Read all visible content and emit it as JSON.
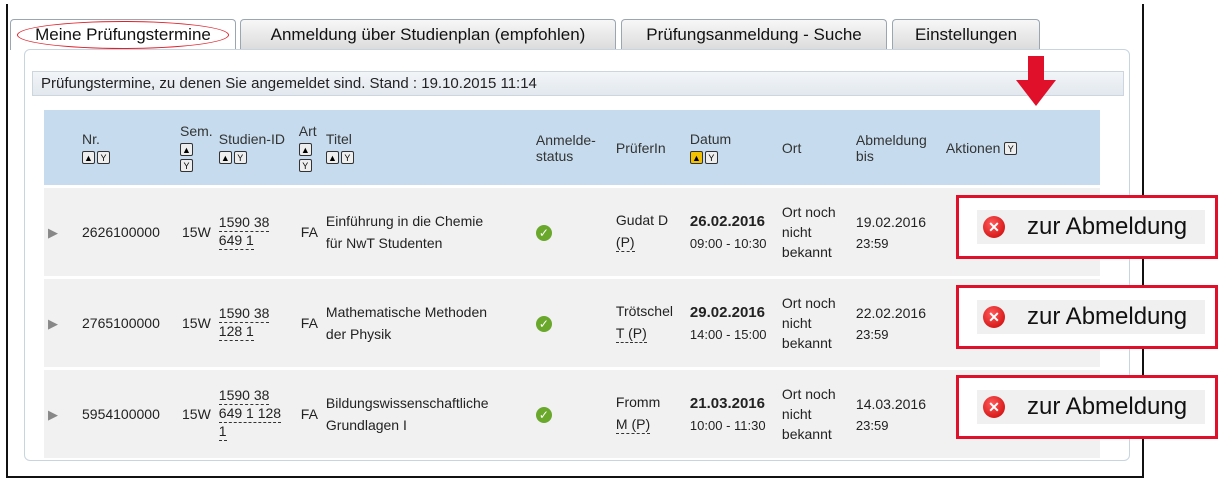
{
  "tabs": [
    {
      "label": "Meine Prüfungstermine",
      "active": true
    },
    {
      "label": "Anmeldung über Studienplan (empfohlen)",
      "active": false
    },
    {
      "label": "Prüfungsanmeldung - Suche",
      "active": false
    },
    {
      "label": "Einstellungen",
      "active": false
    }
  ],
  "section_header": "Prüfungstermine, zu denen Sie angemeldet sind. Stand : 19.10.2015 11:14",
  "columns": {
    "nr": "Nr.",
    "sem": "Sem.",
    "studien_id": "Studien-ID",
    "art": "Art",
    "titel": "Titel",
    "status_line1": "Anmelde-",
    "status_line2": "status",
    "pruefer": "PrüferIn",
    "datum": "Datum",
    "ort": "Ort",
    "abmeldung_line1": "Abmeldung",
    "abmeldung_line2": "bis",
    "aktionen": "Aktionen"
  },
  "rows": [
    {
      "nr": "2626100000",
      "sem": "15W",
      "sid_1": "1590 38",
      "sid_2": "649 1",
      "sid_3": "",
      "art": "FA",
      "titel_1": "Einführung in die Chemie",
      "titel_2": "für NwT Studenten",
      "pruefer_1": "Gudat D",
      "pruefer_2": "(P)",
      "datum": "26.02.2016",
      "zeit": "09:00 - 10:30",
      "ort_1": "Ort noch",
      "ort_2": "nicht",
      "ort_3": "bekannt",
      "abm_date": "19.02.2016",
      "abm_time": "23:59"
    },
    {
      "nr": "2765100000",
      "sem": "15W",
      "sid_1": "1590 38",
      "sid_2": "128 1",
      "sid_3": "",
      "art": "FA",
      "titel_1": "Mathematische Methoden",
      "titel_2": "der Physik",
      "pruefer_1": "Trötschel",
      "pruefer_2": "T (P)",
      "datum": "29.02.2016",
      "zeit": "14:00 - 15:00",
      "ort_1": "Ort noch",
      "ort_2": "nicht",
      "ort_3": "bekannt",
      "abm_date": "22.02.2016",
      "abm_time": "23:59"
    },
    {
      "nr": "5954100000",
      "sem": "15W",
      "sid_1": "1590 38",
      "sid_2": "649 1 128",
      "sid_3": "1",
      "art": "FA",
      "titel_1": "Bildungswissenschaftliche",
      "titel_2": "Grundlagen I",
      "pruefer_1": "Fromm",
      "pruefer_2": "M (P)",
      "datum": "21.03.2016",
      "zeit": "10:00 - 11:30",
      "ort_1": "Ort noch",
      "ort_2": "nicht",
      "ort_3": "bekannt",
      "abm_date": "14.03.2016",
      "abm_time": "23:59"
    }
  ],
  "action_label": "zur Abmeldung",
  "colors": {
    "highlight": "#e0102a",
    "header_bg": "#c6dcee",
    "row_bg": "#f1f1f1",
    "check": "#6aa82c"
  }
}
